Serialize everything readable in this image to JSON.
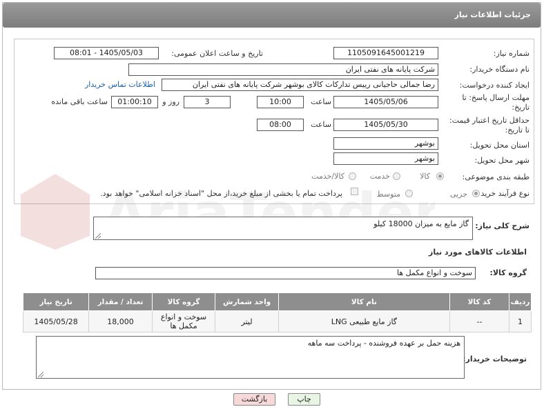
{
  "header": {
    "title": "جزئیات اطلاعات نیاز"
  },
  "fields": {
    "need_number_label": "شماره نیاز:",
    "need_number": "1105091645001219",
    "announce_label": "تاریخ و ساعت اعلان عمومی:",
    "announce_value": "1405/05/03 - 08:01",
    "buyer_org_label": "نام دستگاه خریدار:",
    "buyer_org": "شرکت پایانه های نفتی ایران",
    "creator_label": "ایجاد کننده درخواست:",
    "creator": "رضا جمالی حاجیانی رییس تدارکات کالای بوشهر شرکت پایانه های نفتی ایران",
    "contact_link": "اطلاعات تماس خریدار",
    "deadline_label_1": "مهلت ارسال پاسخ: تا",
    "deadline_label_2": "تاریخ:",
    "deadline_date": "1405/05/06",
    "time_label": "ساعت",
    "deadline_time": "10:00",
    "days_value": "3",
    "days_label": "روز و",
    "remaining_value": "01:00:10",
    "remaining_label": "ساعت باقی مانده",
    "price_label_1": "حداقل تاریخ اعتبار قیمت:",
    "price_label_2": "تا تاریخ:",
    "price_date": "1405/05/30",
    "price_time": "08:00",
    "province_label": "استان محل تحویل:",
    "province": "بوشهر",
    "city_label": "شهر محل تحویل:",
    "city": "بوشهر",
    "category_label": "طبقه بندی موضوعی:",
    "category_options": [
      "کالا",
      "خدمت",
      "کالا/خدمت"
    ],
    "purchase_type_label": "نوع فرآیند خرید :",
    "purchase_options": [
      "جزیی",
      "متوسط"
    ],
    "treasury_text": "پرداخت تمام یا بخشی از مبلغ خرید،از محل \"اسناد خزانه اسلامی\" خواهد بود."
  },
  "description": {
    "label": "شرح کلی نیاز:",
    "value": "گاز مایع به میزان 18000 کیلو"
  },
  "goods_info": {
    "title": "اطلاعات کالاهای مورد نیاز",
    "group_label": "گروه کالا:",
    "group_value": "سوخت و انواع مکمل ها"
  },
  "table": {
    "headers": [
      "ردیف",
      "کد کالا",
      "نام کالا",
      "واحد شمارش",
      "گروه کالا",
      "تعداد / مقدار",
      "تاریخ نیاز"
    ],
    "rows": [
      [
        "1",
        "--",
        "گاز مایع طبیعی LNG",
        "لیتر",
        "سوخت و انواع مکمل ها",
        "18,000",
        "1405/05/28"
      ]
    ]
  },
  "buyer_notes": {
    "label": "توضیحات خریدار:",
    "value": "هزینه حمل بر عهده فروشنده - پرداخت سه ماهه"
  },
  "buttons": {
    "print": "چاپ",
    "back": "بازگشت"
  },
  "watermark": "AriaTender.net",
  "colors": {
    "header_bg": "#8a8a8a",
    "link": "#1a5fa8",
    "back_btn_bg": "#f7d9d9",
    "print_btn_bg": "#e9f5e4"
  }
}
